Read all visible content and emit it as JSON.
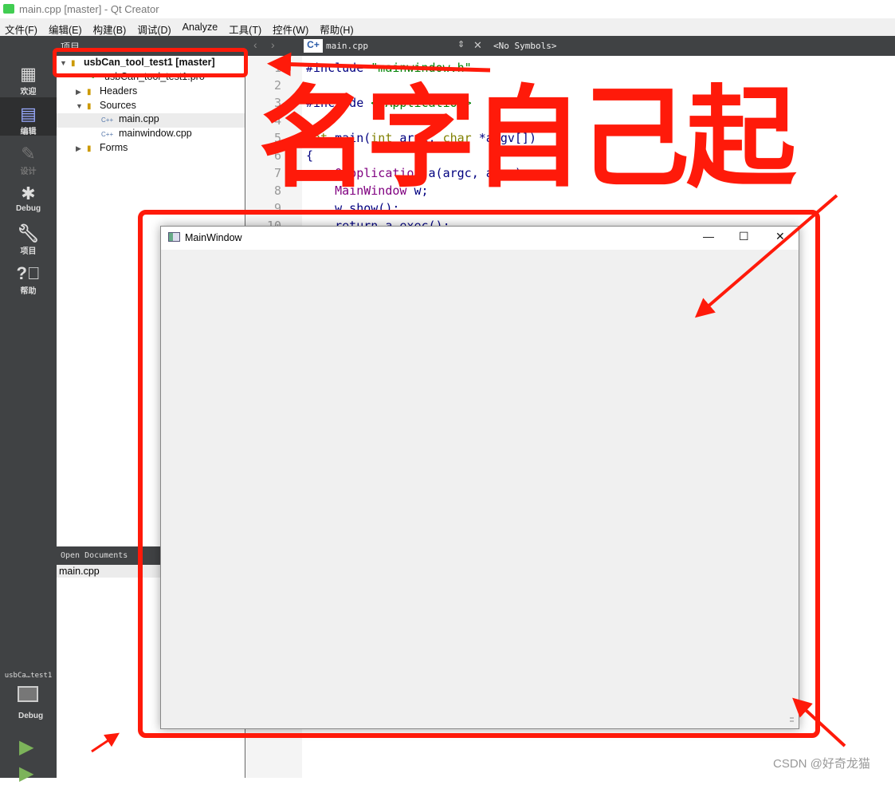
{
  "window": {
    "title": "main.cpp [master] - Qt Creator",
    "logo": "QC"
  },
  "menu": [
    "文件(F)",
    "编辑(E)",
    "构建(B)",
    "调试(D)",
    "Analyze",
    "工具(T)",
    "控件(W)",
    "帮助(H)"
  ],
  "toolbar": {
    "panel_title": "项目",
    "file_tab": "main.cpp",
    "symbols": "<No Symbols>"
  },
  "modes": [
    {
      "icon": "grid-icon",
      "label": "欢迎"
    },
    {
      "icon": "edit-icon",
      "label": "编辑"
    },
    {
      "icon": "pencil-icon",
      "label": "设计"
    },
    {
      "icon": "bug-icon",
      "label": "Debug"
    },
    {
      "icon": "wrench-icon",
      "label": "项目"
    },
    {
      "icon": "help-icon",
      "label": "帮助"
    }
  ],
  "tree": {
    "project": "usbCan_tool_test1 [master]",
    "pro_file": "usbCan_tool_test1.pro",
    "headers": "Headers",
    "sources": "Sources",
    "main": "main.cpp",
    "mainwindow": "mainwindow.cpp",
    "forms": "Forms"
  },
  "open_documents": {
    "header": "Open Documents",
    "items": [
      "main.cpp"
    ]
  },
  "kit": {
    "name": "usbCa…test1",
    "mode": "Debug"
  },
  "code": {
    "lines": [
      "1",
      "2",
      "3",
      "4",
      "5",
      "6",
      "7",
      "8",
      "9",
      "10"
    ],
    "l1a": "#include ",
    "l1b": "\"mainwindow.h\"",
    "l3a": "#include ",
    "l3b": "<QApplication>",
    "l5a": "int",
    "l5b": " main(",
    "l5c": "int",
    "l5d": " argc, ",
    "l5e": "char",
    "l5f": " *argv[])",
    "l6": "{",
    "l7a": "    QApplication",
    "l7b": " a(argc, argv);",
    "l8a": "    MainWindow",
    "l8b": " w;",
    "l9": "    w.show();",
    "l10": "    return a.exec();"
  },
  "mainwindow": {
    "title": "MainWindow",
    "min": "—",
    "max": "☐",
    "close": "✕"
  },
  "annotation": {
    "text": "名字自己起",
    "color": "#ff1a0a"
  },
  "watermark": "CSDN @好奇龙猫"
}
